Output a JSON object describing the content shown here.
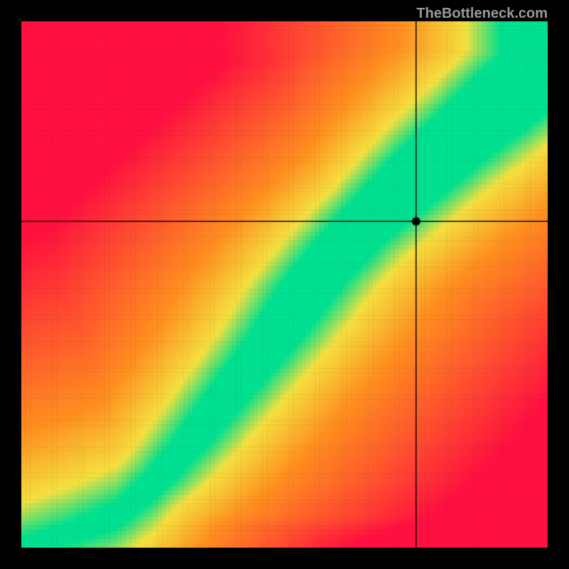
{
  "watermark": "TheBottleneck.com",
  "chart_data": {
    "type": "heatmap",
    "title": "",
    "xlabel": "",
    "ylabel": "",
    "xlim": [
      0,
      100
    ],
    "ylim": [
      0,
      100
    ],
    "crosshair": {
      "x": 75,
      "y": 62
    },
    "marker": {
      "x": 75,
      "y": 62
    },
    "optimal_band": {
      "description": "Green band follows a curve from bottom-left to top-right indicating balanced CPU-GPU pairing",
      "control_points": [
        {
          "x": 0,
          "y": 0
        },
        {
          "x": 10,
          "y": 3
        },
        {
          "x": 18,
          "y": 6
        },
        {
          "x": 25,
          "y": 12
        },
        {
          "x": 32,
          "y": 20
        },
        {
          "x": 40,
          "y": 30
        },
        {
          "x": 48,
          "y": 40
        },
        {
          "x": 55,
          "y": 50
        },
        {
          "x": 62,
          "y": 58
        },
        {
          "x": 70,
          "y": 66
        },
        {
          "x": 78,
          "y": 73
        },
        {
          "x": 88,
          "y": 82
        },
        {
          "x": 100,
          "y": 92
        }
      ],
      "band_width_start": 3,
      "band_width_end": 18
    },
    "color_scale": {
      "optimal": "#00e090",
      "near": "#f5e040",
      "warning": "#ff9020",
      "bottleneck": "#ff1040"
    }
  }
}
